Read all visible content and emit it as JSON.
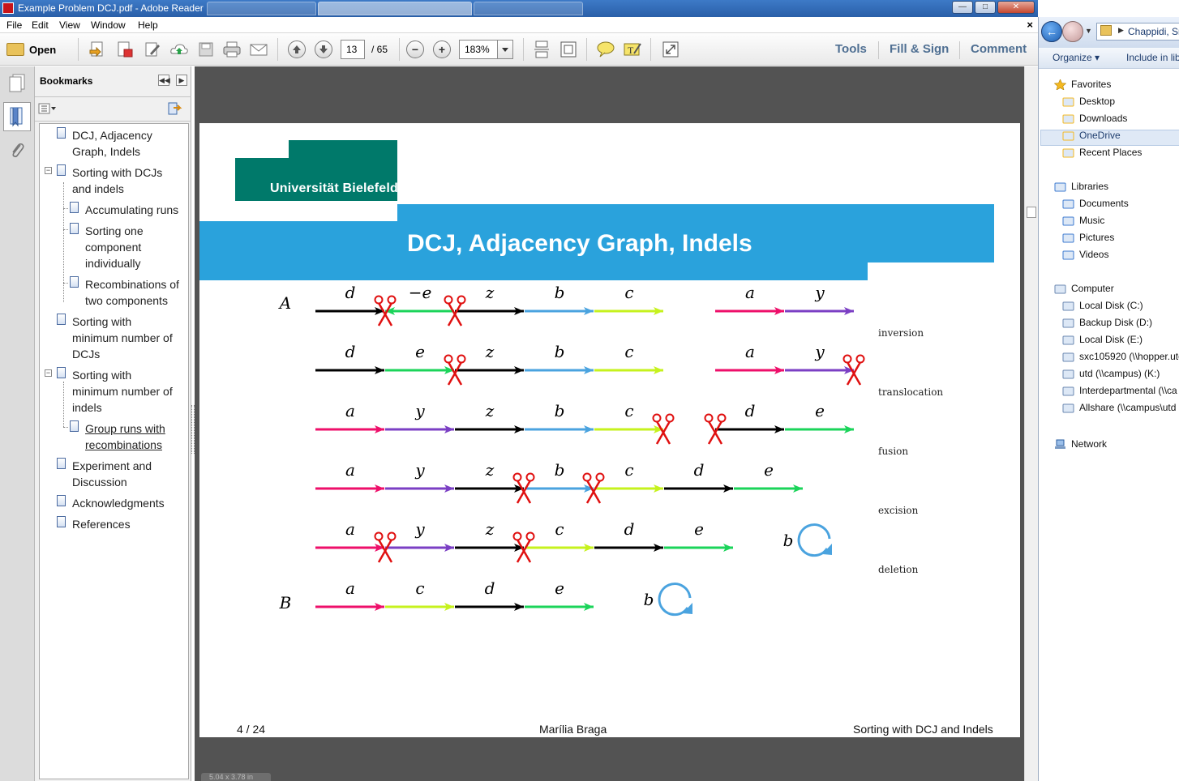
{
  "window": {
    "title": "Example Problem DCJ.pdf - Adobe Reader",
    "min_label": "—",
    "max_label": "□",
    "close_label": "✕"
  },
  "menu": {
    "items": [
      "File",
      "Edit",
      "View",
      "Window",
      "Help"
    ],
    "close_doc": "×"
  },
  "toolbar": {
    "open_label": "Open",
    "page_current": "13",
    "page_total": "/ 65",
    "zoom_value": "183%",
    "tools_label": "Tools",
    "fill_sign_label": "Fill & Sign",
    "comment_label": "Comment"
  },
  "bookmarks": {
    "header": "Bookmarks",
    "items": [
      {
        "lines": [
          "DCJ, Adjacency",
          "Graph, Indels"
        ]
      },
      {
        "lines": [
          "Sorting with DCJs",
          "and indels"
        ]
      },
      {
        "lines": [
          "Accumulating runs"
        ]
      },
      {
        "lines": [
          "Sorting one",
          "component",
          "individually"
        ]
      },
      {
        "lines": [
          "Recombinations of",
          "two components"
        ]
      },
      {
        "lines": [
          "Sorting with",
          "minimum number of",
          "DCJs"
        ]
      },
      {
        "lines": [
          "Sorting with",
          "minimum number of",
          "indels"
        ]
      },
      {
        "lines": [
          "Group runs with",
          "recombinations"
        ]
      },
      {
        "lines": [
          "Experiment and",
          "Discussion"
        ]
      },
      {
        "lines": [
          "Acknowledgments"
        ]
      },
      {
        "lines": [
          "References"
        ]
      }
    ]
  },
  "slide": {
    "university": "Universität Bielefeld",
    "title": "DCJ, Adjacency Graph, Indels",
    "label_A": "A",
    "label_B": "B",
    "operations": [
      "inversion",
      "translocation",
      "fusion",
      "excision",
      "deletion"
    ],
    "rows": [
      {
        "genes": [
          "d",
          "−e",
          "z",
          "b",
          "c",
          "a",
          "y"
        ]
      },
      {
        "genes": [
          "d",
          "e",
          "z",
          "b",
          "c",
          "a",
          "y"
        ]
      },
      {
        "genes": [
          "a",
          "y",
          "z",
          "b",
          "c",
          "d",
          "e"
        ]
      },
      {
        "genes": [
          "a",
          "y",
          "z",
          "b",
          "c",
          "d",
          "e"
        ]
      },
      {
        "genes": [
          "a",
          "y",
          "z",
          "c",
          "d",
          "e",
          "b"
        ]
      },
      {
        "genes": [
          "a",
          "c",
          "d",
          "e",
          "b"
        ]
      }
    ],
    "footer_page": "4 / 24",
    "footer_author": "Marília Braga",
    "footer_title": "Sorting with DCJ and Indels"
  },
  "status": {
    "page_size": "5.04 x 3.78 in"
  },
  "explorer": {
    "path": "Chappidi, Sr",
    "organize": "Organize ▾",
    "include": "Include in lib",
    "favorites": [
      "Favorites",
      "Desktop",
      "Downloads",
      "OneDrive",
      "Recent Places"
    ],
    "libraries": [
      "Libraries",
      "Documents",
      "Music",
      "Pictures",
      "Videos"
    ],
    "computer": [
      "Computer",
      "Local Disk (C:)",
      "Backup Disk (D:)",
      "Local Disk (E:)",
      "sxc105920 (\\\\hopper.utd",
      "utd (\\\\campus) (K:)",
      "Interdepartmental (\\\\ca",
      "Allshare (\\\\campus\\utd"
    ],
    "network": "Network"
  },
  "colors": {
    "green": "#00796a",
    "blue": "#2aa2dc",
    "pink": "#ee0f6a",
    "purple": "#7b3fc4",
    "lightblue": "#4aa3df",
    "lime": "#c6f21d",
    "emerald": "#1bd45a",
    "red": "#e01010"
  }
}
